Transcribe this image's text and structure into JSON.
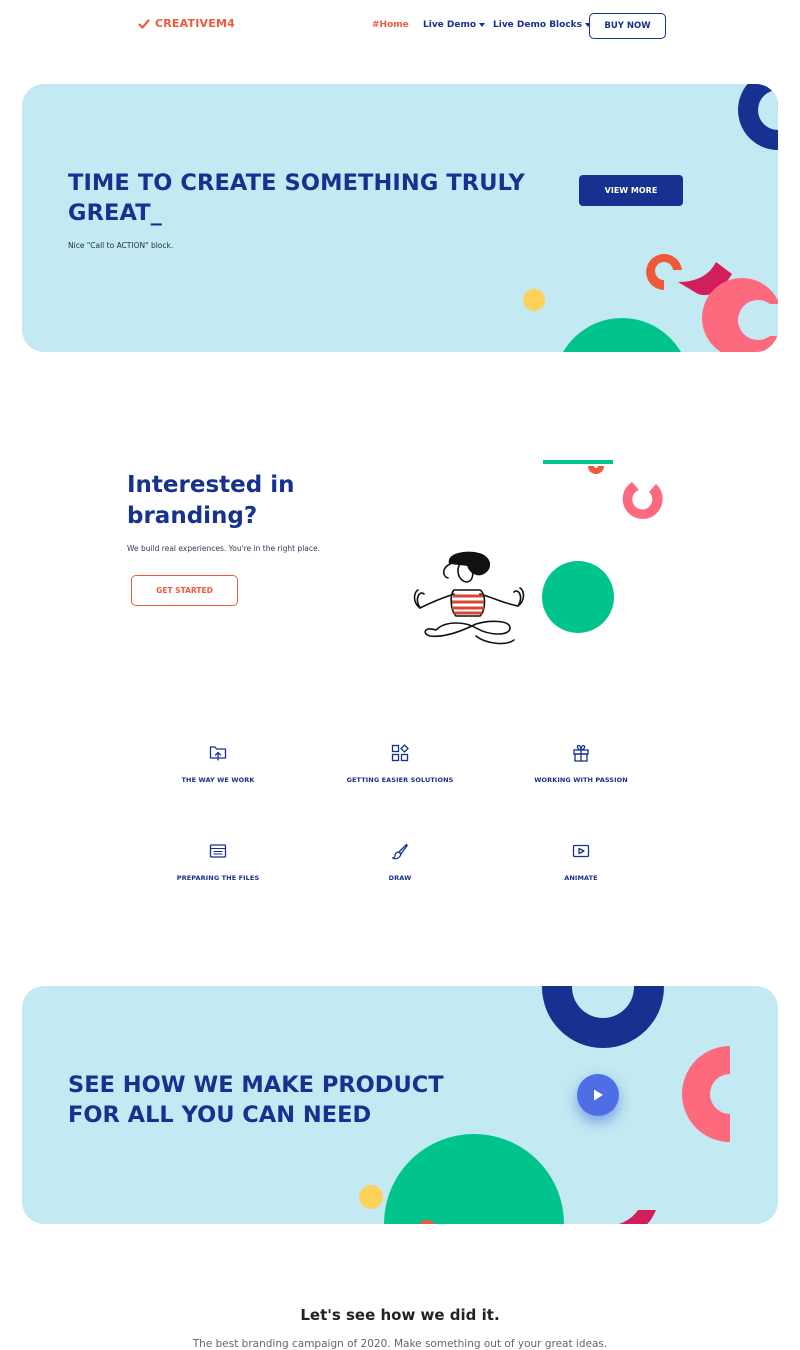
{
  "nav": {
    "brand": "CREATIVEM4",
    "items": [
      {
        "label": "#Home",
        "active": true,
        "dropdown": false
      },
      {
        "label": "Live Demo",
        "active": false,
        "dropdown": true
      },
      {
        "label": "Live Demo Blocks",
        "active": false,
        "dropdown": true
      }
    ],
    "buy_label": "BUY NOW"
  },
  "hero": {
    "title": "TIME TO CREATE SOMETHING TRULY GREAT_",
    "subtitle": "Nice \"Call to ACTION\" block.",
    "button_label": "VIEW MORE"
  },
  "branding": {
    "title": "Interested in branding?",
    "subtitle": "We build real experiences. You're in the right place.",
    "button_label": "GET STARTED"
  },
  "features": [
    {
      "label": "THE WAY WE WORK",
      "icon": "folder-upload-icon"
    },
    {
      "label": "GETTING EASIER SOLUTIONS",
      "icon": "apps-grid-icon"
    },
    {
      "label": "WORKING WITH PASSION",
      "icon": "gift-icon"
    },
    {
      "label": "PREPARING THE FILES",
      "icon": "files-icon"
    },
    {
      "label": "DRAW",
      "icon": "brush-icon"
    },
    {
      "label": "ANIMATE",
      "icon": "video-play-icon"
    }
  ],
  "product": {
    "title": "SEE HOW WE MAKE PRODUCT FOR ALL YOU CAN NEED"
  },
  "how": {
    "title": "Let's see how we did it.",
    "subtitle": "The best branding campaign of 2020. Make something out of your great ideas."
  },
  "colors": {
    "accent": "#f05a3a",
    "brand_blue": "#16318f",
    "card_bg": "#c3eaf2",
    "green": "#00c48c",
    "pink": "#fd6a7e",
    "magenta": "#d61f5c",
    "yellow": "#fdd15a"
  }
}
